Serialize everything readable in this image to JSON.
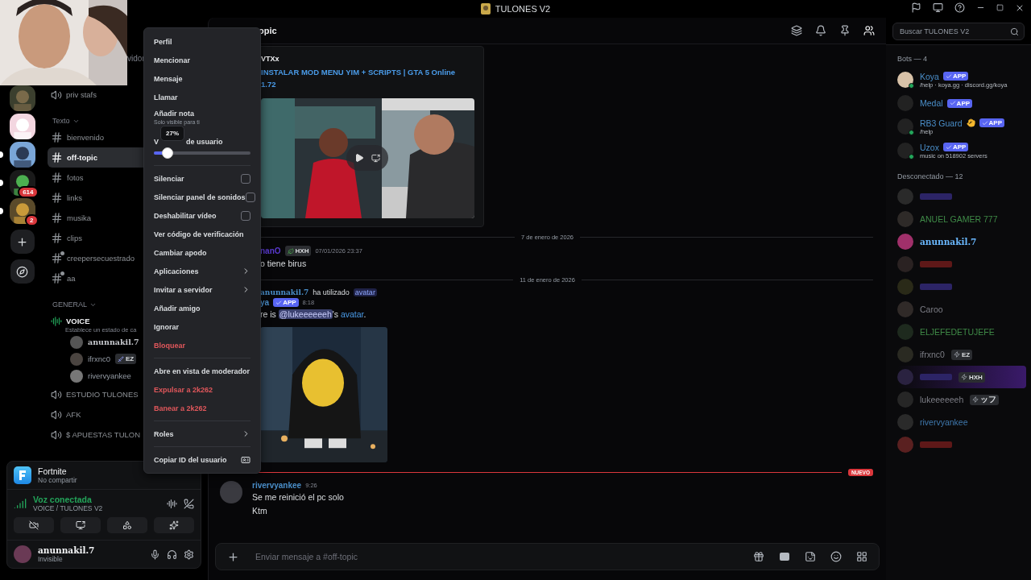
{
  "window": {
    "title": "TULONES V2"
  },
  "servers": [
    {
      "unread": false
    },
    {
      "unread": false
    },
    {
      "unread": true
    },
    {
      "badge": "614",
      "unread": true
    },
    {
      "badge": "2",
      "unread": true
    }
  ],
  "server_header": {
    "title": "vidor"
  },
  "channels": [
    {
      "kind": "voice",
      "name": "priv stafs",
      "selected": false
    },
    {
      "kind": "category",
      "name": "Texto"
    },
    {
      "kind": "text",
      "name": "bienvenido",
      "selected": false,
      "limited": false
    },
    {
      "kind": "text",
      "name": "off-topic",
      "selected": true,
      "limited": false
    },
    {
      "kind": "text",
      "name": "fotos",
      "selected": false,
      "limited": false
    },
    {
      "kind": "text",
      "name": "links",
      "selected": false,
      "limited": false
    },
    {
      "kind": "text",
      "name": "musika",
      "selected": false,
      "limited": false
    },
    {
      "kind": "text",
      "name": "clips",
      "selected": false,
      "limited": false
    },
    {
      "kind": "text",
      "name": "creepersecuestrado",
      "selected": false,
      "limited": true
    },
    {
      "kind": "text",
      "name": "aa",
      "selected": false,
      "limited": true
    },
    {
      "kind": "category",
      "name": "GENERAL"
    },
    {
      "kind": "live",
      "name": "VOICE",
      "status": "Establece un estado de ca",
      "selected": true,
      "children": [
        {
          "name": "anunnakil.7"
        },
        {
          "name": "ifrxnc0",
          "tag": "EZ"
        },
        {
          "name": "rivervyankee"
        }
      ]
    },
    {
      "kind": "voice",
      "name": "ESTUDIO TULONES",
      "selected": false
    },
    {
      "kind": "voice",
      "name": "AFK",
      "selected": false
    },
    {
      "kind": "voice",
      "name": "$ APUESTAS TULON",
      "selected": false
    }
  ],
  "activity": {
    "title": "Fortnite",
    "subtitle": "No compartir"
  },
  "voice_status": {
    "title": "Voz conectada",
    "subtitle": "VOICE / TULONES V2"
  },
  "user": {
    "name": "anunnakil.7",
    "status": "Invisible"
  },
  "chat": {
    "title": "opic",
    "embed": {
      "author": "VTXx",
      "title_lines": [
        "INSTALAR MOD MENU YIM + SCRIPTS | GTA 5 Online",
        "1.72"
      ]
    },
    "messages": [
      {
        "kind": "divider",
        "text": "7 de enero de 2026"
      },
      {
        "kind": "message",
        "author": "nanO",
        "tag": "HXH",
        "time": "07/01/2026 23:37",
        "avatar": false,
        "lines": [
          "o tiene birus"
        ]
      },
      {
        "kind": "divider",
        "text": "11 de enero de 2026"
      },
      {
        "kind": "command",
        "user": "anunnakil.7",
        "action": "ha utilizado",
        "command": "avatar",
        "author": "ya",
        "app_tag": "APP",
        "time": "8:18",
        "before": "re is ",
        "mention": "@lukeeeeeeh",
        "middle": "'s ",
        "link": "avatar",
        "after": "."
      },
      {
        "kind": "new",
        "text": "NUEVO"
      },
      {
        "kind": "message",
        "author": "rivervyankee",
        "time": "9:26",
        "avatar": true,
        "lines": [
          "Se me reinició el pc solo",
          "Ktm"
        ]
      }
    ],
    "composer": {
      "placeholder": "Enviar mensaje a #off-topic"
    }
  },
  "search": {
    "placeholder": "Buscar TULONES V2"
  },
  "members": {
    "bots_heading": "Bots — 4",
    "bots": [
      {
        "name": "Koya",
        "app_tag": "APP",
        "subtitle": "/help · koya.gg · discord.gg/koya",
        "hand": false
      },
      {
        "name": "Medal",
        "app_tag": "APP",
        "hand": false
      },
      {
        "name": "RB3 Guard",
        "app_tag": "APP",
        "subtitle": "/help",
        "hand": true
      },
      {
        "name": "Uzox",
        "app_tag": "APP",
        "subtitle": "music on 518902 servers",
        "hand": false
      }
    ],
    "offline_heading": "Desconectado — 12",
    "offline": [
      {
        "color": "#2c2466"
      },
      {
        "name": "ANUEL GAMER 777",
        "color": "#3f8a47"
      },
      {
        "name": "anunnakil.7",
        "color": "#6ab8ff",
        "self": true
      },
      {
        "color": "#5e1818"
      },
      {
        "color": "#2c2466"
      },
      {
        "name": "Caroo",
        "color": "#7d7e86"
      },
      {
        "name": "ELJEFEDETUJEFE",
        "color": "#3f8a47"
      },
      {
        "name": "ifrxnc0",
        "color": "#7d7e86",
        "tag": "EZ"
      },
      {
        "tag": "HXH",
        "color": "#2c2466"
      },
      {
        "name": "lukeeeeeeh",
        "color": "#7d7e86",
        "tag": "ッフ"
      },
      {
        "name": "rivervyankee",
        "color": "#3f78ad"
      },
      {
        "color": "#5e1818"
      }
    ]
  },
  "menu": [
    {
      "kind": "item",
      "label": "Perfil"
    },
    {
      "kind": "item",
      "label": "Mencionar"
    },
    {
      "kind": "item",
      "label": "Mensaje"
    },
    {
      "kind": "item",
      "label": "Llamar"
    },
    {
      "kind": "note",
      "label": "Añadir nota",
      "hint": "Solo visible para ti"
    },
    {
      "kind": "slider",
      "label_start": "V",
      "label_end": "de usuario",
      "reading": "27%",
      "level": 0.14
    },
    {
      "kind": "divider"
    },
    {
      "kind": "checkbox",
      "label": "Silenciar",
      "checked": false
    },
    {
      "kind": "checkbox",
      "label": "Silenciar panel de sonidos",
      "checked": false
    },
    {
      "kind": "checkbox",
      "label": "Deshabilitar vídeo",
      "checked": false
    },
    {
      "kind": "item",
      "label": "Ver código de verificación"
    },
    {
      "kind": "item",
      "label": "Cambiar apodo"
    },
    {
      "kind": "submenu",
      "label": "Aplicaciones"
    },
    {
      "kind": "submenu",
      "label": "Invitar a servidor"
    },
    {
      "kind": "item",
      "label": "Añadir amigo"
    },
    {
      "kind": "item",
      "label": "Ignorar"
    },
    {
      "kind": "danger",
      "label": "Bloquear"
    },
    {
      "kind": "divider"
    },
    {
      "kind": "item",
      "label": "Abre en vista de moderador"
    },
    {
      "kind": "danger",
      "label": "Expulsar a 2k262"
    },
    {
      "kind": "danger",
      "label": "Banear a 2k262"
    },
    {
      "kind": "divider"
    },
    {
      "kind": "submenu",
      "label": "Roles"
    },
    {
      "kind": "divider"
    },
    {
      "kind": "id",
      "label": "Copiar ID del usuario"
    }
  ]
}
